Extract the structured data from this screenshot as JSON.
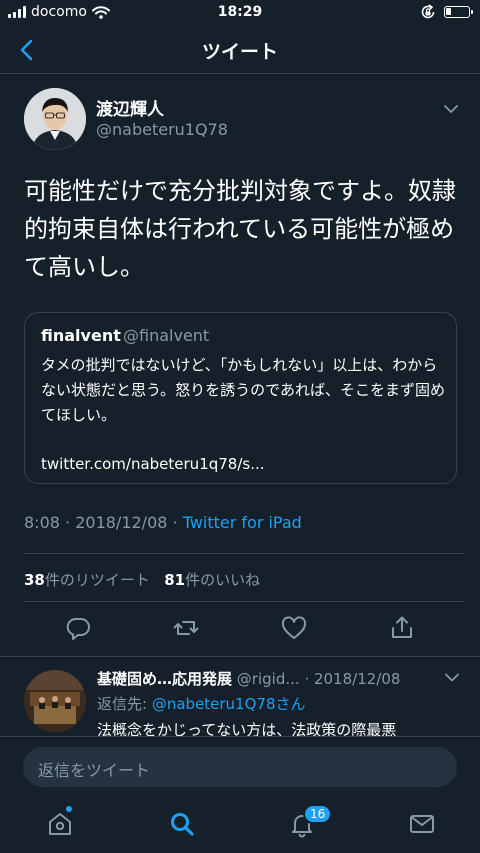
{
  "status_bar": {
    "carrier": "docomo",
    "time": "18:29",
    "icons": [
      "signal-bars-icon",
      "wifi-icon",
      "rotation-lock-icon",
      "battery-icon"
    ],
    "battery_level": 0.25
  },
  "nav": {
    "title": "ツイート",
    "back_icon": "chevron-left-icon"
  },
  "tweet": {
    "display_name": "渡辺輝人",
    "handle": "@nabeteru1Q78",
    "text": "可能性だけで充分批判対象ですよ。奴隷的拘束自体は行われている可能性が極めて高いし。",
    "quote": {
      "display_name": "finalvent",
      "handle": "@finalvent",
      "text": "タメの批判ではないけど、「かもしれない」以上は、わからない状態だと思う。怒りを誘うのであれば、そこをまず固めてほしい。",
      "link": "twitter.com/nabeteru1q78/s..."
    },
    "time": "8:08",
    "date": "2018/12/08",
    "source": "Twitter for iPad",
    "retweet_count": "38",
    "retweet_label": "件のリツイート",
    "like_count": "81",
    "like_label": "件のいいね",
    "actions": [
      "reply-icon",
      "retweet-icon",
      "like-icon",
      "share-icon"
    ]
  },
  "reply": {
    "display_name": "基礎固め…応用発展",
    "handle": "@rigid...",
    "date": "· 2018/12/08",
    "reply_to_label": "返信先: ",
    "reply_to_user": "@nabeteru1Q78さん",
    "text": "法概念をかじってない方は、法政策の際最悪"
  },
  "compose": {
    "placeholder": "返信をツイート"
  },
  "tab_bar": {
    "items": [
      "home-icon",
      "search-icon",
      "notifications-icon",
      "messages-icon"
    ],
    "active": "search-icon",
    "notification_badge": "16"
  },
  "colors": {
    "background": "#15202b",
    "accent": "#1da1f2",
    "secondary_text": "#8899a6",
    "border": "#38444d"
  }
}
